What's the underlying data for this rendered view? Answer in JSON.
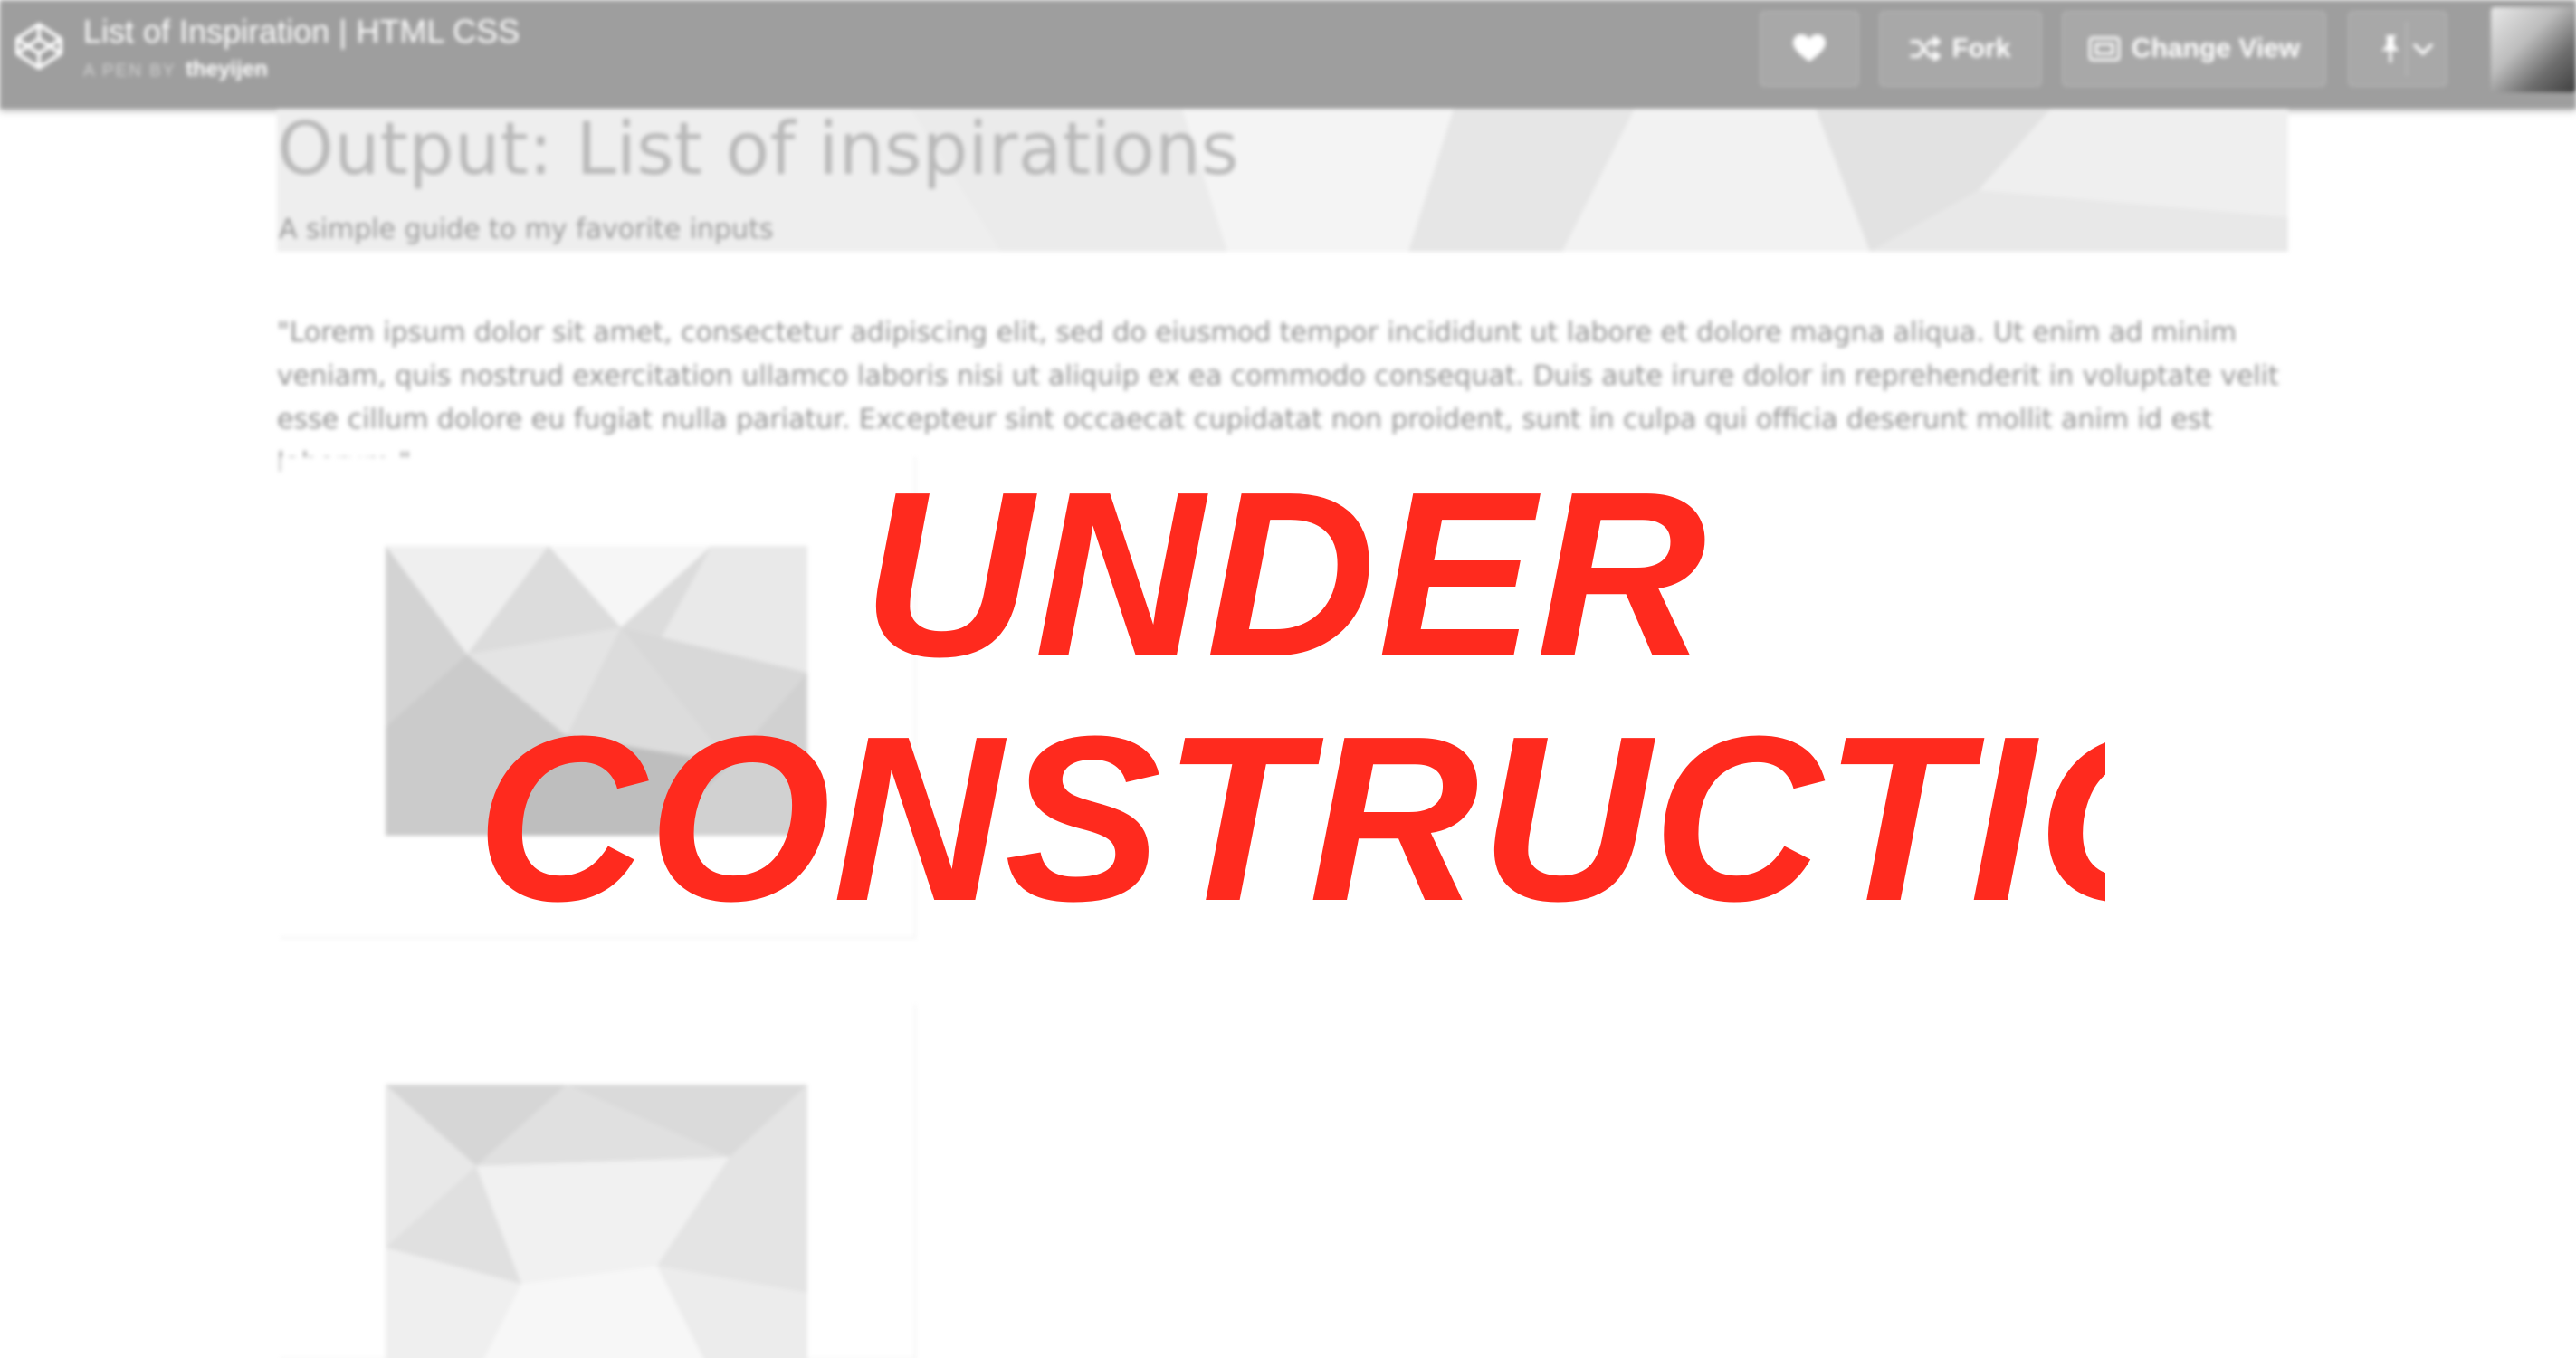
{
  "topbar": {
    "title": "List of Inspiration | HTML CSS",
    "by_prefix": "A PEN BY",
    "author": "theyijen",
    "icons": {
      "logo": "codepen-logo-icon",
      "heart": "heart-icon",
      "fork": "fork-icon",
      "change_view": "change-view-icon",
      "pin": "pin-icon",
      "dropdown": "chevron-down-icon"
    },
    "buttons": {
      "fork_label": "Fork",
      "change_view_label": "Change View"
    }
  },
  "page": {
    "heading": "Output: List of inspirations",
    "subheading": "A simple guide to my favorite inputs",
    "lorem": "\"Lorem ipsum dolor sit amet, consectetur adipiscing elit, sed do eiusmod tempor incididunt ut labore et dolore magna aliqua. Ut enim ad minim veniam, quis nostrud exercitation ullamco laboris nisi ut aliquip ex ea commodo consequat. Duis aute irure dolor in reprehenderit in voluptate velit esse cillum dolore eu fugiat nulla pariatur. Excepteur sint occaecat cupidatat non proident, sunt in culpa qui officia deserunt mollit anim id est laborum.\""
  },
  "overlay": {
    "line1": "UNDER",
    "line2": "CONSTRUCTION",
    "color": "#ff2a1e"
  },
  "colors": {
    "topbar": "#9e9e9e",
    "heading": "#b9b9b9",
    "body_text": "#8f8f8f"
  }
}
